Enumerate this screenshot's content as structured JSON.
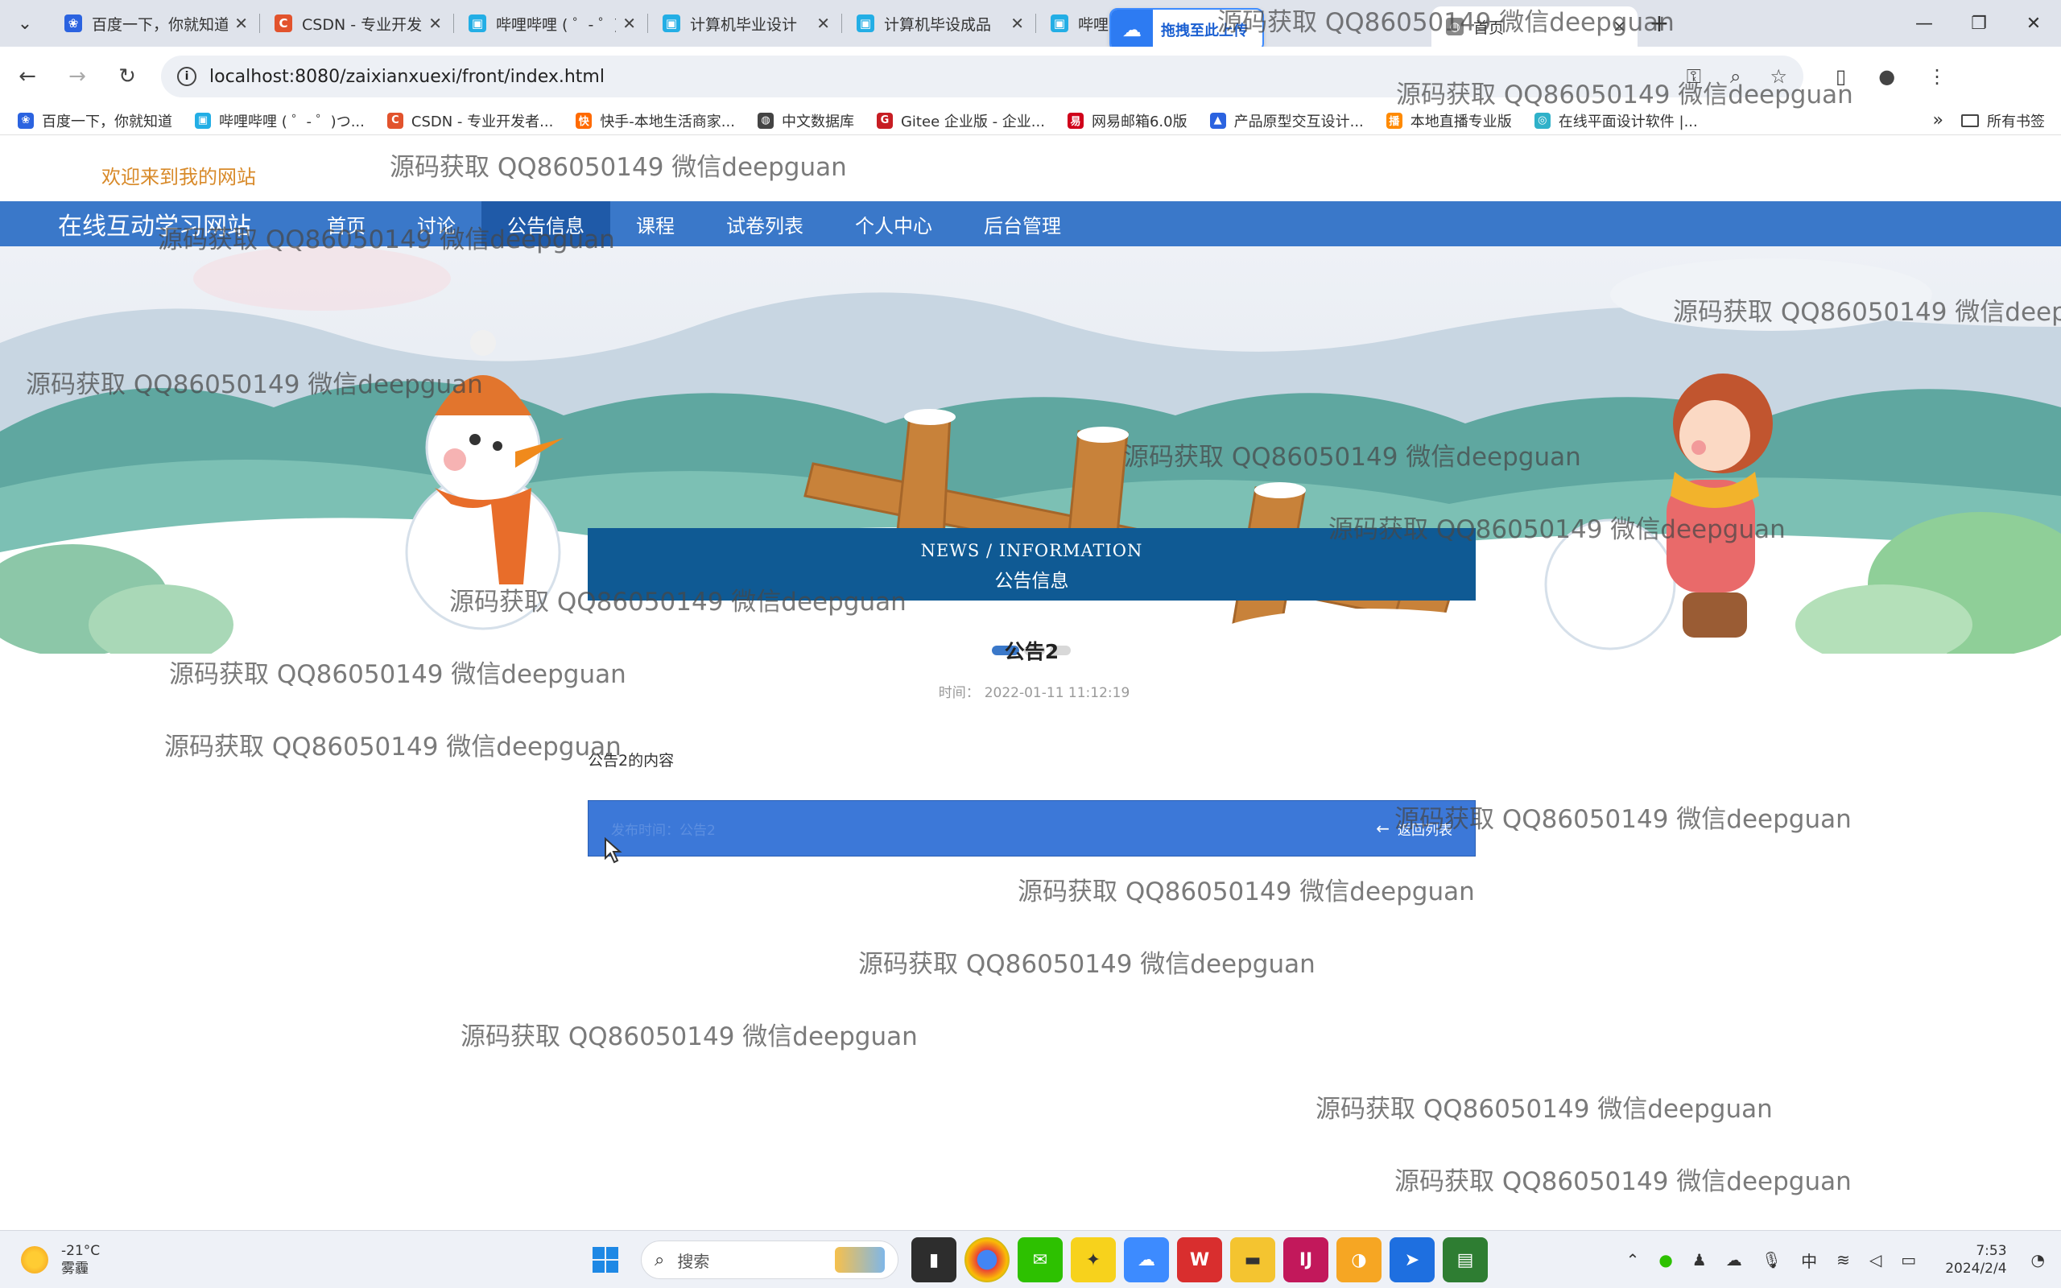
{
  "browser": {
    "tabs": [
      {
        "title": "百度一下，你就知道",
        "icon_color": "#2b63e0",
        "icon": "paw-icon"
      },
      {
        "title": "CSDN - 专业开发者社区",
        "icon_color": "#e2532d",
        "icon": "csdn-icon"
      },
      {
        "title": "哔哩哔哩 ( ゜- ゜)つロ",
        "icon_color": "#23aee5",
        "icon": "bilibili-icon"
      },
      {
        "title": "计算机毕业设计",
        "icon_color": "#23aee5",
        "icon": "bilibili-icon"
      },
      {
        "title": "计算机毕设成品",
        "icon_color": "#23aee5",
        "icon": "bilibili-icon"
      },
      {
        "title": "哔哩哔哩",
        "icon_color": "#23aee5",
        "icon": "bilibili-icon"
      },
      {
        "title": "首页",
        "icon_color": "#888888",
        "icon": "globe-icon",
        "active": true
      }
    ],
    "upload_pill": "拖拽至此上传",
    "url": "localhost:8080/zaixianxuexi/front/index.html",
    "bookmarks": [
      {
        "label": "百度一下，你就知道",
        "color": "#2b63e0"
      },
      {
        "label": "哔哩哔哩 ( ゜- ゜)つ...",
        "color": "#23aee5"
      },
      {
        "label": "CSDN - 专业开发者...",
        "color": "#e2532d"
      },
      {
        "label": "快手-本地生活商家...",
        "color": "#ff6a00"
      },
      {
        "label": "中文数据库",
        "color": "#444444"
      },
      {
        "label": "Gitee 企业版 - 企业...",
        "color": "#c71d23"
      },
      {
        "label": "网易邮箱6.0版",
        "color": "#d0021b"
      },
      {
        "label": "产品原型交互设计...",
        "color": "#2b63e0"
      },
      {
        "label": "本地直播专业版",
        "color": "#ff8a00"
      },
      {
        "label": "在线平面设计软件 |...",
        "color": "#2fb1c9"
      }
    ],
    "bookmarks_more": "»",
    "all_bookmarks": "所有书签"
  },
  "site": {
    "welcome": "欢迎来到我的网站",
    "brand": "在线互动学习网站",
    "nav": [
      "首页",
      "讨论",
      "公告信息",
      "课程",
      "试卷列表",
      "个人中心",
      "后台管理"
    ],
    "active_nav": 2
  },
  "news": {
    "heading_en": "NEWS / INFORMATION",
    "heading_cn": "公告信息",
    "title": "公告2",
    "time_label": "时间：",
    "time_value": "2022-01-11 11:12:19",
    "content": "公告2的内容",
    "footer_left": "发布时间：公告2",
    "back_label": "返回列表"
  },
  "watermark": "源码获取 QQ86050149 微信deepguan",
  "taskbar": {
    "temperature": "-21°C",
    "condition": "雾霾",
    "search_placeholder": "搜索",
    "time": "7:53",
    "date": "2024/2/4"
  }
}
